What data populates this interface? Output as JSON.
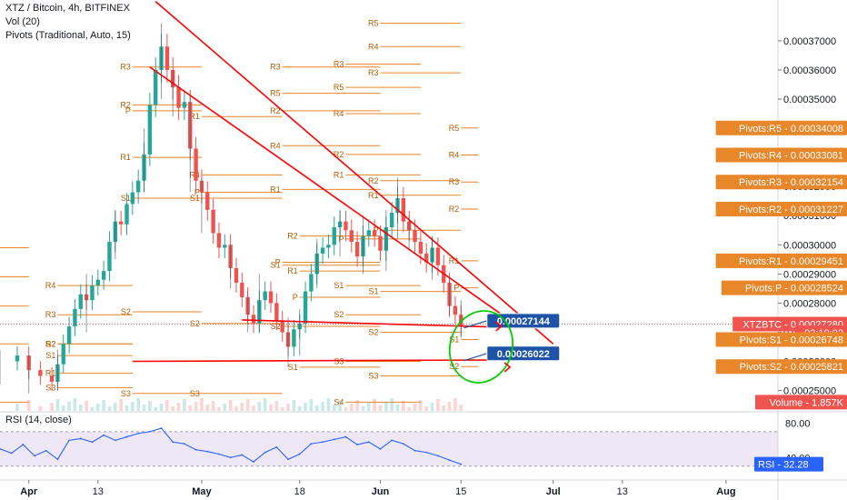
{
  "legend": {
    "title": "XTZ / Bitcoin, 4h, BITFINEX",
    "vol": "Vol (20)",
    "pivots": "Pivots (Traditional, Auto, 15)"
  },
  "rsi_legend": "RSI (14, close)",
  "colors": {
    "up": "#26a69a",
    "down": "#ef5350",
    "pivot": "#e8862a",
    "pivot_label": "#b35c00",
    "trend": "#ff0000",
    "rsi": "#2962ff",
    "rsi_band": "#ede7f6",
    "price_tag": "#ef5350",
    "callout": "#1e53a8",
    "ellipse": "#00cc00"
  },
  "chart_data": [
    {
      "type": "candlestick",
      "title": "XTZ / Bitcoin, 4h, BITFINEX",
      "y_ticks": [
        "0.00037000",
        "0.00036000",
        "0.00035000",
        "0.00034000",
        "0.00033000",
        "0.00032000",
        "0.00031000",
        "0.00030000",
        "0.00029000",
        "0.00028000",
        "0.00027000",
        "0.00026000",
        "0.00025000"
      ],
      "y_tick_values": [
        0.00037,
        0.00036,
        0.00035,
        0.00034,
        0.00033,
        0.00032,
        0.00031,
        0.0003,
        0.00029,
        0.00028,
        0.00027,
        0.00026,
        0.00025
      ],
      "ylim": [
        0.000243,
        0.000384
      ],
      "x_ticks": [
        "Apr",
        "13",
        "May",
        "18",
        "Jun",
        "15",
        "Jul",
        "13",
        "Aug"
      ],
      "x_tick_days": [
        0,
        12,
        30,
        47,
        61,
        75,
        91,
        103,
        121
      ],
      "xlim": [
        -5,
        130
      ],
      "series_close": [
        [
          -5,
          0.00026
        ],
        [
          -2,
          0.000262
        ],
        [
          0,
          0.000257
        ],
        [
          2,
          0.000255
        ],
        [
          4,
          0.000253
        ],
        [
          5,
          0.000259
        ],
        [
          6,
          0.000266
        ],
        [
          7,
          0.000272
        ],
        [
          8,
          0.000278
        ],
        [
          9,
          0.000283
        ],
        [
          10,
          0.000281
        ],
        [
          11,
          0.000286
        ],
        [
          12,
          0.000288
        ],
        [
          13,
          0.000291
        ],
        [
          14,
          0.000301
        ],
        [
          15,
          0.000308
        ],
        [
          16,
          0.000307
        ],
        [
          17,
          0.000314
        ],
        [
          18,
          0.000318
        ],
        [
          19,
          0.000322
        ],
        [
          20,
          0.000331
        ],
        [
          21,
          0.000348
        ],
        [
          22,
          0.00036
        ],
        [
          23,
          0.000368
        ],
        [
          24,
          0.00036
        ],
        [
          25,
          0.000354
        ],
        [
          26,
          0.000347
        ],
        [
          27,
          0.000349
        ],
        [
          28,
          0.000333
        ],
        [
          29,
          0.000322
        ],
        [
          30,
          0.000318
        ],
        [
          31,
          0.000312
        ],
        [
          32,
          0.000304
        ],
        [
          33,
          0.000299
        ],
        [
          34,
          0.0003
        ],
        [
          35,
          0.000292
        ],
        [
          36,
          0.000287
        ],
        [
          37,
          0.000282
        ],
        [
          38,
          0.000276
        ],
        [
          39,
          0.000273
        ],
        [
          40,
          0.000281
        ],
        [
          41,
          0.000284
        ],
        [
          42,
          0.00028
        ],
        [
          43,
          0.000274
        ],
        [
          44,
          0.00027
        ],
        [
          45,
          0.000265
        ],
        [
          46,
          0.000271
        ],
        [
          47,
          0.000273
        ],
        [
          48,
          0.000284
        ],
        [
          49,
          0.00029
        ],
        [
          50,
          0.000297
        ],
        [
          51,
          0.000299
        ],
        [
          52,
          0.0003
        ],
        [
          53,
          0.000306
        ],
        [
          54,
          0.000308
        ],
        [
          55,
          0.000305
        ],
        [
          56,
          0.000301
        ],
        [
          57,
          0.000296
        ],
        [
          58,
          0.000303
        ],
        [
          59,
          0.000305
        ],
        [
          60,
          0.000303
        ],
        [
          61,
          0.000298
        ],
        [
          62,
          0.000306
        ],
        [
          63,
          0.000311
        ],
        [
          64,
          0.000316
        ],
        [
          65,
          0.000308
        ],
        [
          66,
          0.000305
        ],
        [
          67,
          0.000301
        ],
        [
          68,
          0.000297
        ],
        [
          69,
          0.000294
        ],
        [
          70,
          0.000299
        ],
        [
          71,
          0.000293
        ],
        [
          72,
          0.000287
        ],
        [
          73,
          0.000279
        ],
        [
          74,
          0.000276
        ],
        [
          75,
          0.000272
        ]
      ],
      "series_wick": [
        [
          -5,
          0.000264,
          0.000252
        ],
        [
          0,
          0.000262,
          0.000249
        ],
        [
          5,
          0.000264,
          0.00025
        ],
        [
          10,
          0.00029,
          0.00027
        ],
        [
          15,
          0.000312,
          0.000295
        ],
        [
          20,
          0.00034,
          0.000318
        ],
        [
          23,
          0.000376,
          0.00035
        ],
        [
          25,
          0.00036,
          0.000344
        ],
        [
          28,
          0.000351,
          0.000318
        ],
        [
          30,
          0.000323,
          0.000304
        ],
        [
          35,
          0.0003,
          0.000285
        ],
        [
          38,
          0.000284,
          0.00027
        ],
        [
          40,
          0.00029,
          0.00027
        ],
        [
          45,
          0.000275,
          0.000258
        ],
        [
          47,
          0.000278,
          0.000262
        ],
        [
          50,
          0.000302,
          0.000285
        ],
        [
          54,
          0.000312,
          0.000296
        ],
        [
          58,
          0.00031,
          0.00029
        ],
        [
          62,
          0.000312,
          0.000291
        ],
        [
          64,
          0.000323,
          0.000302
        ],
        [
          66,
          0.00031,
          0.000298
        ],
        [
          70,
          0.000303,
          0.000288
        ],
        [
          73,
          0.000288,
          0.000275
        ],
        [
          75,
          0.000281,
          0.000268
        ]
      ],
      "price_scale_labels": [
        {
          "text": "Pivots:R5 - 0.00034008",
          "value": 0.00034008,
          "bg": "#e8862a"
        },
        {
          "text": "Pivots:R4 - 0.00033081",
          "value": 0.00033081,
          "bg": "#e8862a"
        },
        {
          "text": "Pivots:R3 - 0.00032154",
          "value": 0.00032154,
          "bg": "#e8862a"
        },
        {
          "text": "Pivots:R2 - 0.00031227",
          "value": 0.00031227,
          "bg": "#e8862a"
        },
        {
          "text": "Pivots:R1 - 0.00029451",
          "value": 0.00029451,
          "bg": "#e8862a"
        },
        {
          "text": "Pivots:P - 0.00028524",
          "value": 0.00028524,
          "bg": "#e8862a"
        },
        {
          "text": "XTZBTC - 0.00027280",
          "value": 0.0002728,
          "bg": "#ef5350"
        },
        {
          "text": "02:19:02",
          "value": 0.0002698,
          "bg": "#ef5350"
        },
        {
          "text": "Pivots:S1 - 0.00026748",
          "value": 0.00026748,
          "bg": "#e8862a"
        },
        {
          "text": "Pivots:S2 - 0.00025821",
          "value": 0.00025821,
          "bg": "#e8862a"
        },
        {
          "text": "Volume - 1.857K",
          "value": 0.000246,
          "bg": "#ef5350"
        }
      ],
      "pivot_periods": [
        {
          "x0": -5,
          "x1": 0,
          "levels": {
            "R4": 0.000299,
            "R3": 0.000289,
            "R2": 0.000279,
            "R1": 0.000266,
            "S1": 0.000246
          }
        },
        {
          "x0": 5,
          "x1": 18,
          "levels": {
            "R4": 0.000286,
            "R3": 0.000276,
            "R2": 0.000266,
            "R1": 0.000256,
            "S1": 0.000262,
            "S2": 0.000266,
            "S3": 0.000251
          }
        },
        {
          "x0": 18,
          "x1": 30,
          "levels": {
            "R3": 0.000361,
            "R2": 0.000348,
            "R1": 0.00033,
            "P": 0.000346,
            "S1": 0.000316,
            "S2": 0.000277,
            "S3": 0.000249
          }
        },
        {
          "x0": 30,
          "x1": 44,
          "levels": {
            "R1": 0.000344,
            "P": 0.000318,
            "S1": 0.000316,
            "R4": 0.000324,
            "S2": 0.000273,
            "S3": 0.000249
          }
        },
        {
          "x0": 44,
          "x1": 61,
          "levels": {
            "R3": 0.000361,
            "R2": 0.000346,
            "R1": 0.000319,
            "P": 0.000294,
            "S1": 0.000293,
            "S2": 0.000272,
            "R4": 0.000334,
            "R5": 0.000352
          }
        },
        {
          "x0": 47,
          "x1": 61,
          "levels": {
            "R2": 0.000303,
            "R1": 0.000291,
            "P": 0.000282,
            "S1": 0.000258
          }
        },
        {
          "x0": 55,
          "x1": 68,
          "levels": {
            "R3": 0.000362,
            "R2": 0.000331,
            "R1": 0.000324,
            "P": 0.000302,
            "S1": 0.000286,
            "S2": 0.000276,
            "S3": 0.00026,
            "S4": 0.000246,
            "R4": 0.000345,
            "R5": 0.000354
          }
        },
        {
          "x0": 61,
          "x1": 75,
          "levels": {
            "R5": 0.000376,
            "R4": 0.000368,
            "R3": 0.000359,
            "R2": 0.000322,
            "R1": 0.000317,
            "P": 0.000305,
            "S1": 0.000284,
            "S2": 0.00027,
            "S3": 0.000255
          }
        },
        {
          "x0": 75,
          "x1": 78,
          "levels": {
            "R5": 0.00034008,
            "R4": 0.00033081,
            "R3": 0.00032154,
            "R2": 0.00031227,
            "R1": 0.00029451,
            "P": 0.00028524,
            "S1": 0.00026748,
            "S2": 0.00025821
          }
        }
      ],
      "callouts": [
        {
          "text": "0.00027144",
          "value": 0.00027144
        },
        {
          "text": "0.00026022",
          "value": 0.00026022
        }
      ]
    },
    {
      "type": "line",
      "title": "RSI (14, close)",
      "y_ticks": [
        "80.00",
        "40.00"
      ],
      "ylim": [
        15,
        92
      ],
      "band": [
        30,
        70
      ],
      "last_value_label": "RSI - 32.28",
      "last_value": 32.28,
      "x": [
        -5,
        -3,
        -1,
        1,
        3,
        5,
        7,
        9,
        11,
        13,
        15,
        17,
        19,
        21,
        23,
        25,
        27,
        29,
        31,
        33,
        35,
        37,
        39,
        41,
        43,
        45,
        47,
        49,
        51,
        53,
        55,
        57,
        59,
        61,
        63,
        65,
        67,
        69,
        71,
        73,
        75
      ],
      "values": [
        50,
        45,
        55,
        42,
        48,
        38,
        60,
        62,
        58,
        66,
        60,
        64,
        68,
        70,
        74,
        58,
        56,
        49,
        47,
        44,
        40,
        43,
        35,
        46,
        52,
        38,
        44,
        56,
        58,
        61,
        64,
        55,
        58,
        50,
        60,
        56,
        48,
        46,
        42,
        37,
        32.28
      ]
    }
  ]
}
